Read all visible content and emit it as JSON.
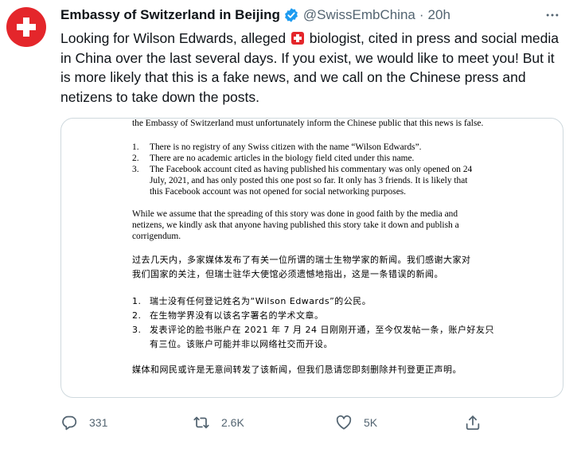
{
  "tweet": {
    "display_name": "Embassy of Switzerland in Beijing",
    "handle": "@SwissEmbChina",
    "separator": "·",
    "time": "20h",
    "text_before_flag": "Looking for Wilson Edwards, alleged ",
    "text_after_flag": " biologist, cited in press and social media in China over the last several days. If you exist, we would like to meet you! But it is more likely that this is a fake news, and we call on the Chinese press and netizens to take down the posts."
  },
  "document": {
    "intro_line": "the Embassy of Switzerland must unfortunately inform the Chinese public that this news is false.",
    "en_items": [
      {
        "num": "1.",
        "lines": [
          "There is no registry of any Swiss citizen with the name “Wilson Edwards”."
        ]
      },
      {
        "num": "2.",
        "lines": [
          "There are no academic articles in the biology field cited under this name."
        ]
      },
      {
        "num": "3.",
        "lines": [
          "The Facebook account cited as having published his commentary was only opened on 24",
          "July, 2021, and has only posted this one post so far. It only has 3 friends. It is likely that",
          "this Facebook account was not opened for social networking purposes."
        ]
      }
    ],
    "en_paragraph": [
      "While we assume that the spreading of this story was done in good faith by the media and",
      "netizens, we kindly ask that anyone having published this story take it down and publish a",
      "corrigendum."
    ],
    "zh_paragraph": [
      "过去几天内，多家媒体发布了有关一位所谓的瑞士生物学家的新闻。我们感谢大家对",
      "我们国家的关注，但瑞士驻华大使馆必须遗憾地指出，这是一条错误的新闻。"
    ],
    "zh_items": [
      {
        "num": "1.",
        "lines": [
          "瑞士没有任何登记姓名为“Wilson Edwards”的公民。"
        ]
      },
      {
        "num": "2.",
        "lines": [
          "在生物学界没有以该名字署名的学术文章。"
        ]
      },
      {
        "num": "3.",
        "lines": [
          "发表评论的脸书账户在 2021 年 7 月 24 日刚刚开通，至今仅发帖一条，账户好友只",
          "有三位。该账户可能并非以网络社交而开设。"
        ]
      }
    ],
    "zh_closing": "媒体和网民或许是无意间转发了该新闻，但我们恳请您即刻删除并刊登更正声明。"
  },
  "actions": {
    "reply_count": "331",
    "retweet_count": "2.6K",
    "like_count": "5K"
  },
  "icons": {
    "avatar": "swiss-cross-avatar",
    "verified": "verified-badge-icon",
    "more": "more-dots-icon",
    "reply": "reply-icon",
    "retweet": "retweet-icon",
    "like": "heart-icon",
    "share": "share-icon"
  },
  "colors": {
    "swiss_red": "#e4262b",
    "twitter_blue": "#1d9bf0",
    "secondary_text": "#536471"
  }
}
